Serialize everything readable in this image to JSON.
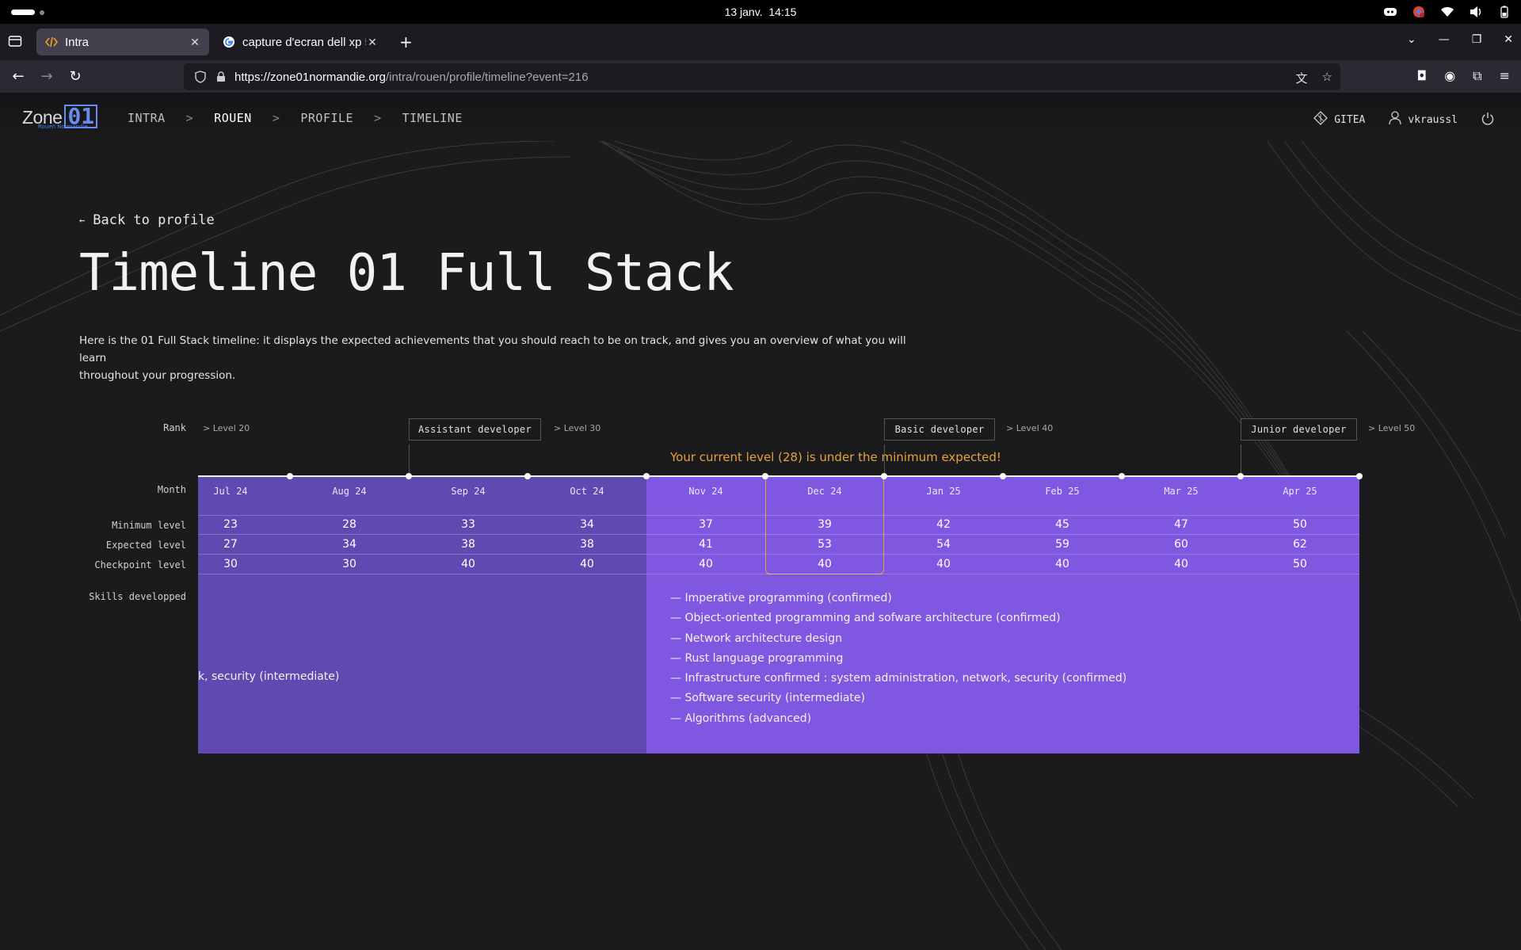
{
  "os": {
    "date": "13 janv.",
    "time": "14:15"
  },
  "browser": {
    "tabs": [
      {
        "title": "Intra",
        "active": true,
        "favicon": "code-icon"
      },
      {
        "title": "capture d'ecran dell xp 5",
        "active": false,
        "favicon": "google-icon"
      }
    ],
    "url": {
      "host": "https://zone01normandie.org",
      "path": "/intra/rouen/profile/timeline?event=216"
    }
  },
  "header": {
    "logo_text": "Zone",
    "logo_mark": "01",
    "logo_sub": "Rouen Normandie",
    "breadcrumb": [
      "INTRA",
      "ROUEN",
      "PROFILE",
      "TIMELINE"
    ],
    "separator": ">",
    "gitea_label": "GITEA",
    "username": "vkraussl"
  },
  "page": {
    "back_label": "Back to profile",
    "title": "Timeline 01 Full Stack",
    "description_line1": "Here is the 01 Full Stack timeline: it displays the expected achievements that you should reach to be on track, and gives you an overview of what you will learn",
    "description_line2": "throughout your progression."
  },
  "timeline": {
    "row_labels": {
      "rank": "Rank",
      "month": "Month",
      "minimum": "Minimum level",
      "expected": "Expected level",
      "checkpoint": "Checkpoint level",
      "skills": "Skills developped"
    },
    "rank_levels": [
      "> Level 20",
      "> Level 30",
      "> Level 40",
      "> Level 50"
    ],
    "ranks": [
      "Assistant developer",
      "Basic developer",
      "Junior developer"
    ],
    "warning": "Your current level (28) is under the minimum expected!",
    "months": [
      "Jul 24",
      "Aug 24",
      "Sep 24",
      "Oct 24",
      "Nov 24",
      "Dec 24",
      "Jan 25",
      "Feb 25",
      "Mar 25",
      "Apr 25"
    ],
    "minimum": [
      "23",
      "28",
      "33",
      "34",
      "37",
      "39",
      "42",
      "45",
      "47",
      "50"
    ],
    "expected": [
      "27",
      "34",
      "38",
      "38",
      "41",
      "53",
      "54",
      "59",
      "60",
      "62"
    ],
    "checkpoint": [
      "30",
      "30",
      "40",
      "40",
      "40",
      "40",
      "40",
      "40",
      "40",
      "50"
    ],
    "current_month": "Dec 24",
    "skill_past_fragment": "k, security (intermediate)",
    "skills": [
      "— Imperative programming (confirmed)",
      "— Object-oriented programming and sofware architecture (confirmed)",
      "— Network architecture design",
      "— Rust language programming",
      "— Infrastructure confirmed : system administration, network, security (confirmed)",
      "— Software security (intermediate)",
      "— Algorithms (advanced)"
    ],
    "colors": {
      "past_band": "#6149b2",
      "future_band": "#7f57e0",
      "warning": "#e6a23c"
    }
  }
}
